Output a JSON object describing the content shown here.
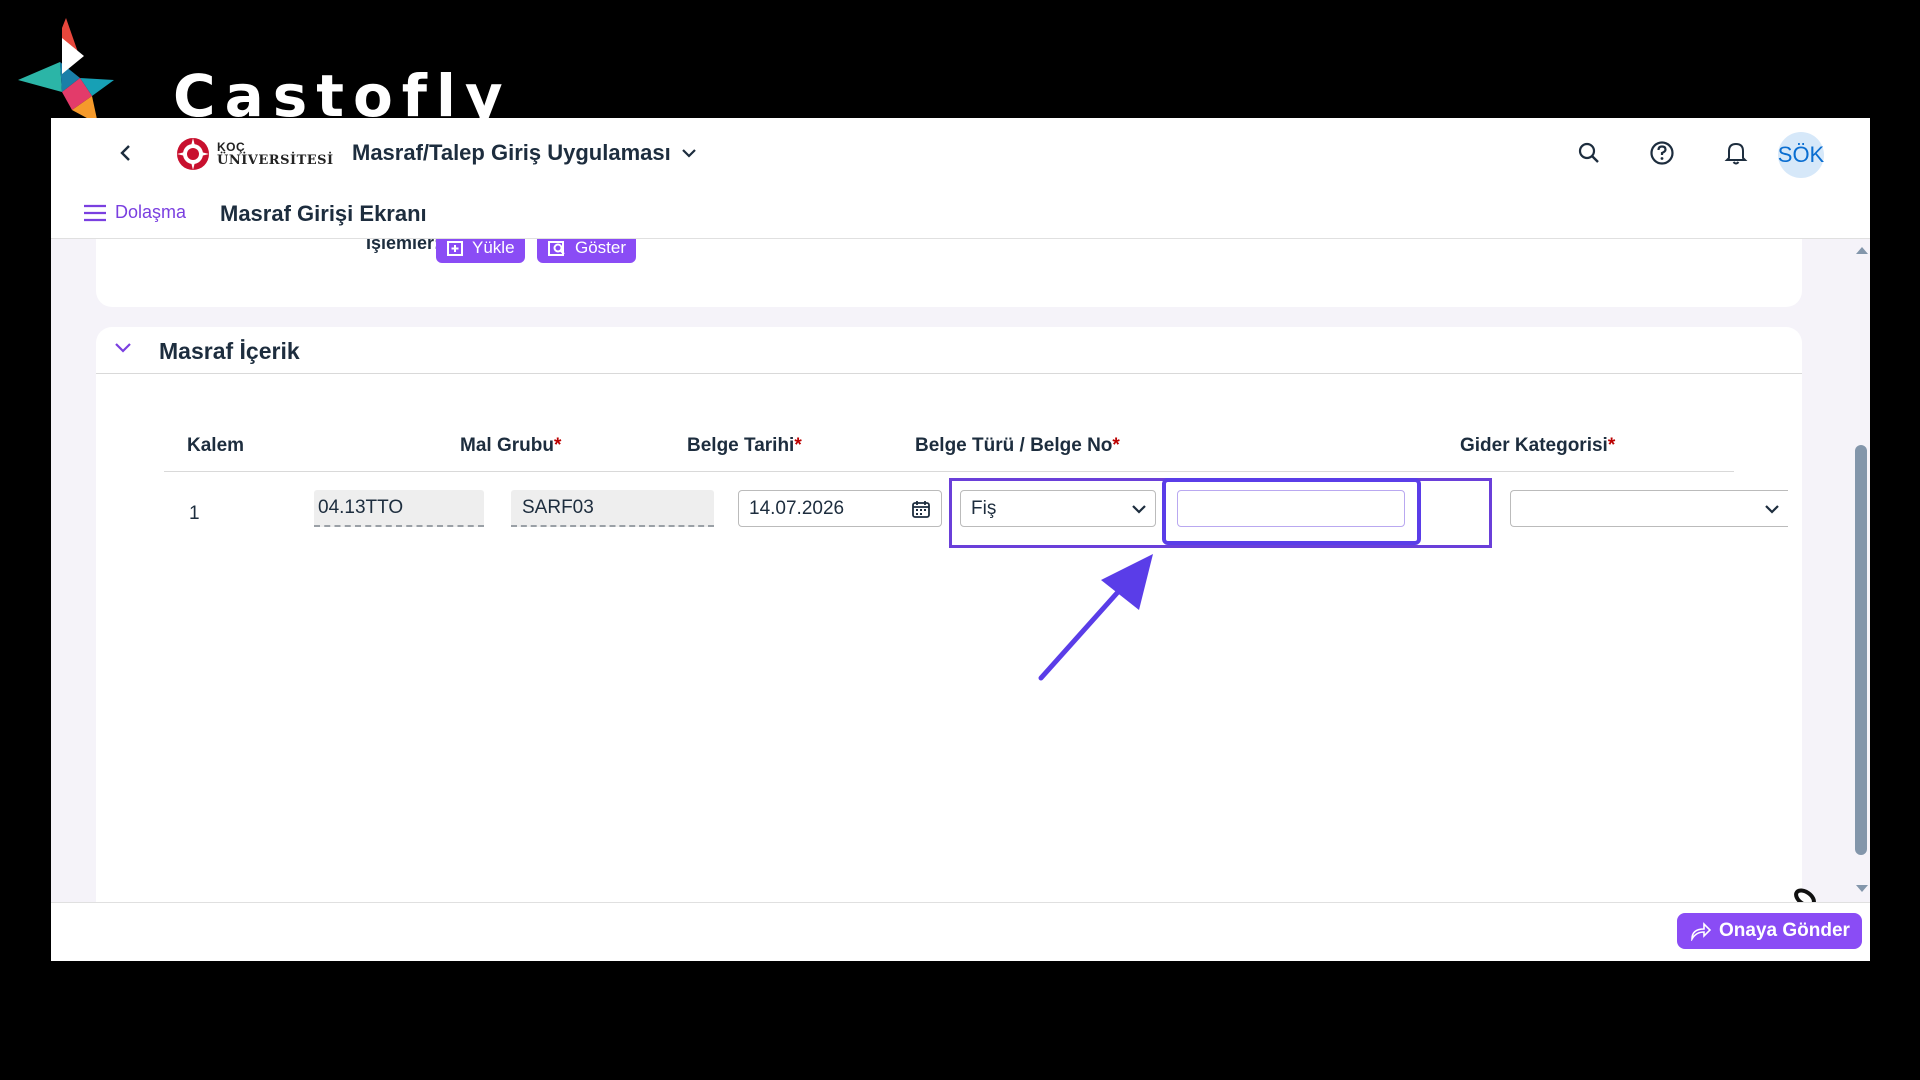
{
  "watermark": {
    "brand_name": "Castofly"
  },
  "shellbar": {
    "logo_line1": "KOÇ",
    "logo_line2": "ÜNİVERSİTESİ",
    "app_title": "Masraf/Talep Giriş Uygulaması",
    "avatar_initials": "SÖK"
  },
  "subbar": {
    "nav_label": "Dolaşma",
    "page_title": "Masraf Girişi Ekranı"
  },
  "operations": {
    "label": "İşlemler:",
    "upload_label": "Yükle",
    "show_label": "Göster"
  },
  "section": {
    "title": "Masraf İçerik",
    "columns": {
      "kalem": "Kalem",
      "mal_grubu": "Mal Grubu",
      "belge_tarihi": "Belge Tarihi",
      "belge_turu_no": "Belge Türü / Belge No",
      "gider_kategorisi": "Gider Kategorisi"
    },
    "required_marker": "*",
    "row": {
      "kalem": "1",
      "code": "04.13TTO",
      "mal_grubu": "SARF03",
      "belge_tarihi": "14.07.2026",
      "belge_turu": "Fiş",
      "belge_no": "",
      "gider_kategorisi": ""
    }
  },
  "footer": {
    "submit_label": "Onaya Gönder"
  },
  "colors": {
    "accent": "#8a4cf5",
    "highlight": "#5a3de8",
    "required": "#bb0000",
    "scroll": "#8396ab"
  }
}
